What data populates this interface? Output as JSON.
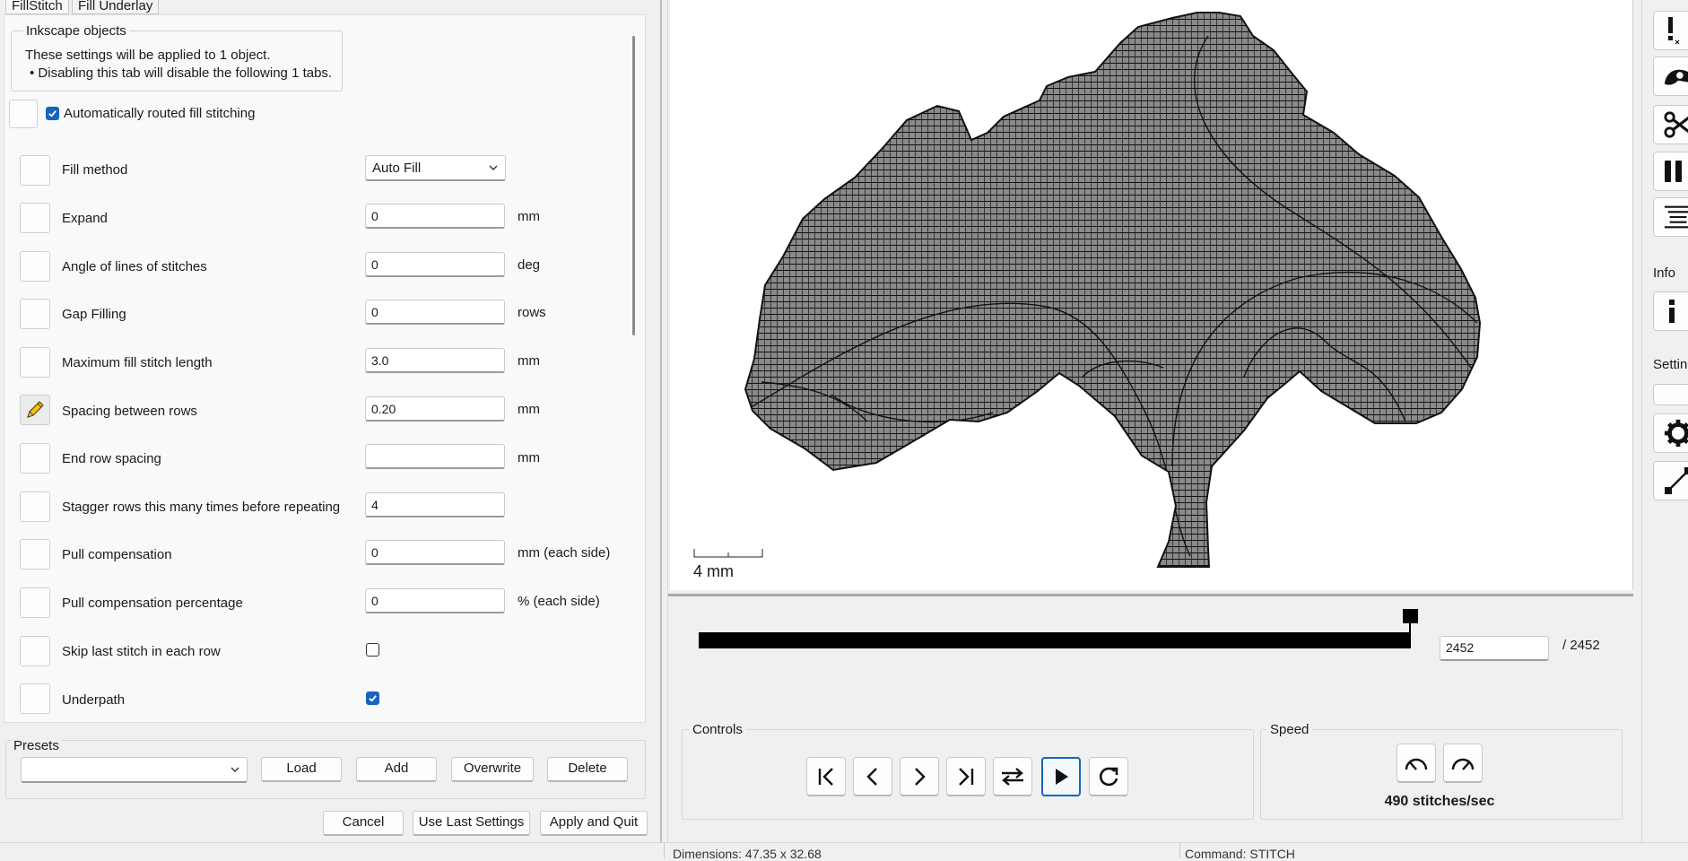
{
  "tabs": [
    {
      "label": "FillStitch",
      "active": true
    },
    {
      "label": "Fill Underlay",
      "active": false
    }
  ],
  "info_group": {
    "title": "Inkscape objects",
    "line1": "These settings will be applied to 1 object.",
    "line2": "• Disabling this tab will disable the following 1 tabs."
  },
  "enable_checkbox": {
    "label": "Automatically routed fill stitching",
    "checked": true
  },
  "settings": {
    "fill_method": {
      "label": "Fill method",
      "value": "Auto Fill"
    },
    "expand": {
      "label": "Expand",
      "value": "0",
      "unit": "mm"
    },
    "angle": {
      "label": "Angle of lines of stitches",
      "value": "0",
      "unit": "deg"
    },
    "gap_filling": {
      "label": "Gap Filling",
      "value": "0",
      "unit": "rows"
    },
    "max_stitch": {
      "label": "Maximum fill stitch length",
      "value": "3.0",
      "unit": "mm"
    },
    "row_spacing": {
      "label": "Spacing between rows",
      "value": "0.20",
      "unit": "mm",
      "edited": true
    },
    "end_row_spacing": {
      "label": "End row spacing",
      "value": "",
      "unit": "mm"
    },
    "stagger": {
      "label": "Stagger rows this many times before repeating",
      "value": "4"
    },
    "pull_comp": {
      "label": "Pull compensation",
      "value": "0",
      "unit": "mm (each side)"
    },
    "pull_comp_pct": {
      "label": "Pull compensation percentage",
      "value": "0",
      "unit": "% (each side)"
    },
    "skip_last": {
      "label": "Skip last stitch in each row",
      "checked": false
    },
    "underpath": {
      "label": "Underpath",
      "checked": true
    }
  },
  "presets": {
    "title": "Presets",
    "selected": "",
    "load": "Load",
    "add": "Add",
    "overwrite": "Overwrite",
    "delete": "Delete"
  },
  "dialog_buttons": {
    "cancel": "Cancel",
    "use_last": "Use Last Settings",
    "apply_quit": "Apply and Quit"
  },
  "preview": {
    "scale_label": "4 mm",
    "current_stitch": "2452",
    "total_label": "/ 2452",
    "progress": 1.0
  },
  "controls": {
    "title": "Controls",
    "buttons": [
      "skip-to-start",
      "previous-stitch",
      "next-stitch",
      "skip-to-end",
      "swap-direction",
      "play",
      "restart"
    ]
  },
  "speed": {
    "title": "Speed",
    "label": "490 stitches/sec"
  },
  "sidebar": {
    "info_label": "Info",
    "settings_label": "Setting"
  },
  "status": {
    "dimensions": "Dimensions: 47.35 x 32.68",
    "command": "Command: STITCH"
  },
  "colors": {
    "accent": "#1565c0",
    "canvas": "#ffffff",
    "stitch": "#000000"
  }
}
